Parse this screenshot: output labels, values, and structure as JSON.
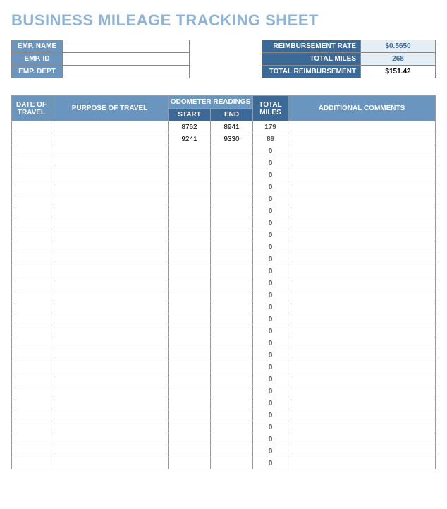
{
  "title": "BUSINESS MILEAGE TRACKING SHEET",
  "employee": {
    "name_label": "EMP. NAME",
    "name_value": "",
    "id_label": "EMP. ID",
    "id_value": "",
    "dept_label": "EMP. DEPT",
    "dept_value": ""
  },
  "summary": {
    "rate_label": "REIMBURSEMENT RATE",
    "rate_value": "$0.5650",
    "miles_label": "TOTAL MILES",
    "miles_value": "268",
    "reimb_label": "TOTAL REIMBURSEMENT",
    "reimb_value": "$151.42"
  },
  "headers": {
    "date": "DATE OF TRAVEL",
    "purpose": "PURPOSE OF TRAVEL",
    "odometer": "ODOMETER READINGS",
    "start": "START",
    "end": "END",
    "total_miles": "TOTAL MILES",
    "comments": "ADDITIONAL COMMENTS"
  },
  "rows": [
    {
      "date": "",
      "purpose": "",
      "start": "8762",
      "end": "8941",
      "miles": "179",
      "comments": ""
    },
    {
      "date": "",
      "purpose": "",
      "start": "9241",
      "end": "9330",
      "miles": "89",
      "comments": ""
    },
    {
      "date": "",
      "purpose": "",
      "start": "",
      "end": "",
      "miles": "0",
      "comments": ""
    },
    {
      "date": "",
      "purpose": "",
      "start": "",
      "end": "",
      "miles": "0",
      "comments": ""
    },
    {
      "date": "",
      "purpose": "",
      "start": "",
      "end": "",
      "miles": "0",
      "comments": ""
    },
    {
      "date": "",
      "purpose": "",
      "start": "",
      "end": "",
      "miles": "0",
      "comments": ""
    },
    {
      "date": "",
      "purpose": "",
      "start": "",
      "end": "",
      "miles": "0",
      "comments": ""
    },
    {
      "date": "",
      "purpose": "",
      "start": "",
      "end": "",
      "miles": "0",
      "comments": ""
    },
    {
      "date": "",
      "purpose": "",
      "start": "",
      "end": "",
      "miles": "0",
      "comments": ""
    },
    {
      "date": "",
      "purpose": "",
      "start": "",
      "end": "",
      "miles": "0",
      "comments": ""
    },
    {
      "date": "",
      "purpose": "",
      "start": "",
      "end": "",
      "miles": "0",
      "comments": ""
    },
    {
      "date": "",
      "purpose": "",
      "start": "",
      "end": "",
      "miles": "0",
      "comments": ""
    },
    {
      "date": "",
      "purpose": "",
      "start": "",
      "end": "",
      "miles": "0",
      "comments": ""
    },
    {
      "date": "",
      "purpose": "",
      "start": "",
      "end": "",
      "miles": "0",
      "comments": ""
    },
    {
      "date": "",
      "purpose": "",
      "start": "",
      "end": "",
      "miles": "0",
      "comments": ""
    },
    {
      "date": "",
      "purpose": "",
      "start": "",
      "end": "",
      "miles": "0",
      "comments": ""
    },
    {
      "date": "",
      "purpose": "",
      "start": "",
      "end": "",
      "miles": "0",
      "comments": ""
    },
    {
      "date": "",
      "purpose": "",
      "start": "",
      "end": "",
      "miles": "0",
      "comments": ""
    },
    {
      "date": "",
      "purpose": "",
      "start": "",
      "end": "",
      "miles": "0",
      "comments": ""
    },
    {
      "date": "",
      "purpose": "",
      "start": "",
      "end": "",
      "miles": "0",
      "comments": ""
    },
    {
      "date": "",
      "purpose": "",
      "start": "",
      "end": "",
      "miles": "0",
      "comments": ""
    },
    {
      "date": "",
      "purpose": "",
      "start": "",
      "end": "",
      "miles": "0",
      "comments": ""
    },
    {
      "date": "",
      "purpose": "",
      "start": "",
      "end": "",
      "miles": "0",
      "comments": ""
    },
    {
      "date": "",
      "purpose": "",
      "start": "",
      "end": "",
      "miles": "0",
      "comments": ""
    },
    {
      "date": "",
      "purpose": "",
      "start": "",
      "end": "",
      "miles": "0",
      "comments": ""
    },
    {
      "date": "",
      "purpose": "",
      "start": "",
      "end": "",
      "miles": "0",
      "comments": ""
    },
    {
      "date": "",
      "purpose": "",
      "start": "",
      "end": "",
      "miles": "0",
      "comments": ""
    },
    {
      "date": "",
      "purpose": "",
      "start": "",
      "end": "",
      "miles": "0",
      "comments": ""
    },
    {
      "date": "",
      "purpose": "",
      "start": "",
      "end": "",
      "miles": "0",
      "comments": ""
    }
  ]
}
